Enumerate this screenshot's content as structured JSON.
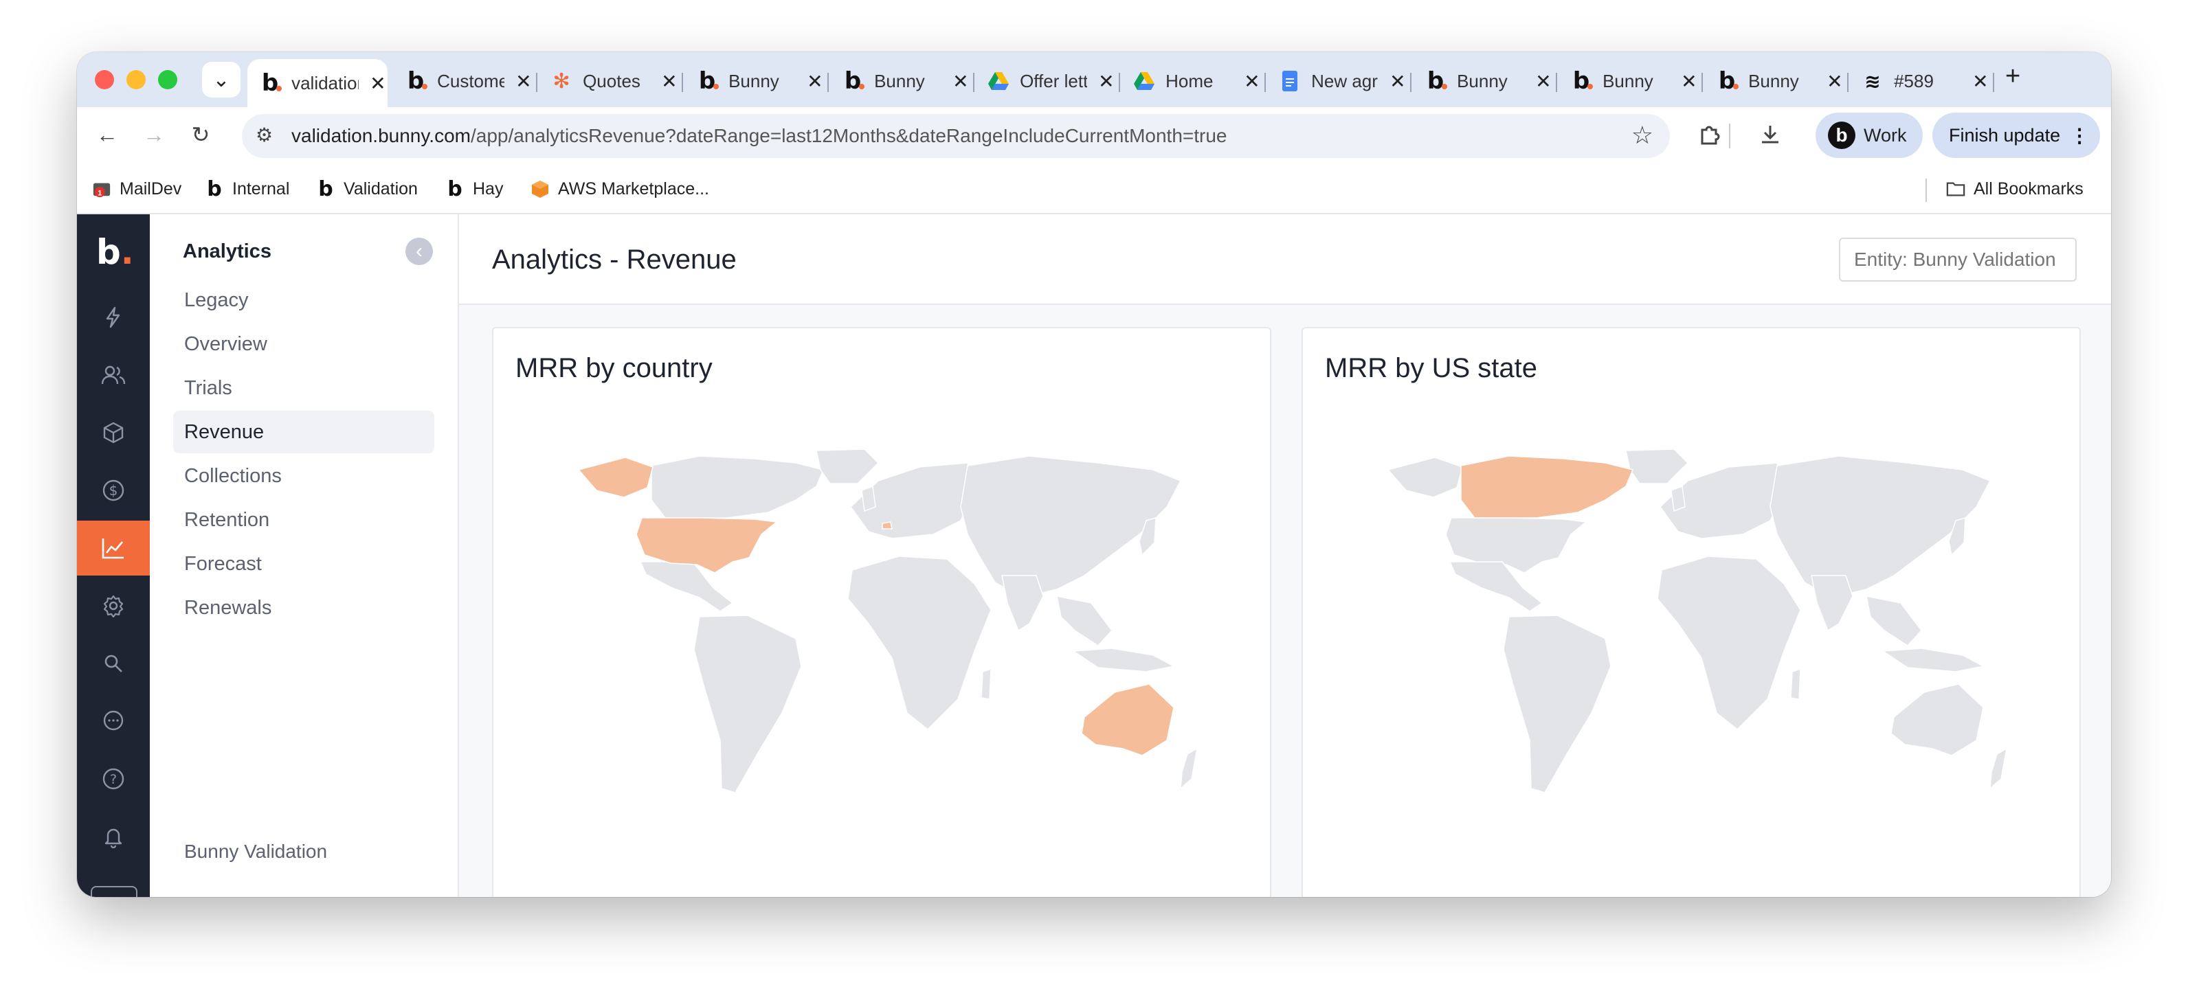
{
  "browser": {
    "tabs": [
      {
        "title": "validation.bunny.com",
        "icon": "bunny-logo-icon",
        "active": true
      },
      {
        "title": "Customers",
        "icon": "bunny-logo-icon"
      },
      {
        "title": "Quotes",
        "icon": "hubspot-icon"
      },
      {
        "title": "Bunny",
        "icon": "bunny-logo-icon"
      },
      {
        "title": "Bunny",
        "icon": "bunny-logo-icon"
      },
      {
        "title": "Offer letter",
        "icon": "google-drive-icon"
      },
      {
        "title": "Home",
        "icon": "google-drive-icon"
      },
      {
        "title": "New agreement",
        "icon": "google-docs-icon"
      },
      {
        "title": "Bunny",
        "icon": "bunny-logo-icon"
      },
      {
        "title": "Bunny",
        "icon": "bunny-logo-icon"
      },
      {
        "title": "Bunny",
        "icon": "bunny-logo-icon"
      },
      {
        "title": "#589",
        "icon": "stack-icon"
      }
    ],
    "url_host": "validation.bunny.com",
    "url_path": "/app/analyticsRevenue?dateRange=last12Months&dateRangeIncludeCurrentMonth=true",
    "profile_label": "Work",
    "update_label": "Finish update",
    "bookmarks": [
      {
        "label": "MailDev",
        "icon": "maildev-icon"
      },
      {
        "label": "Internal",
        "icon": "bunny-logo-icon"
      },
      {
        "label": "Validation",
        "icon": "bunny-logo-icon"
      },
      {
        "label": "Hay",
        "icon": "bunny-logo-icon"
      },
      {
        "label": "AWS Marketplace...",
        "icon": "aws-marketplace-icon"
      }
    ],
    "all_bookmarks_label": "All Bookmarks"
  },
  "app": {
    "logo": "b",
    "rail_items": [
      {
        "name": "quotes",
        "icon": "lightning-icon",
        "active": false
      },
      {
        "name": "customers",
        "icon": "users-icon",
        "active": false
      },
      {
        "name": "products",
        "icon": "box-icon",
        "active": false
      },
      {
        "name": "billing",
        "icon": "dollar-circle-icon",
        "active": false
      },
      {
        "name": "analytics",
        "icon": "chart-line-icon",
        "active": true
      },
      {
        "name": "settings",
        "icon": "gear-icon",
        "active": false
      },
      {
        "name": "search",
        "icon": "search-icon",
        "active": false
      },
      {
        "name": "chat",
        "icon": "chat-icon",
        "active": false
      },
      {
        "name": "help",
        "icon": "help-icon",
        "active": false
      },
      {
        "name": "notifications",
        "icon": "bell-icon",
        "active": false
      }
    ],
    "subnav": {
      "heading": "Analytics",
      "items": [
        "Legacy",
        "Overview",
        "Trials",
        "Revenue",
        "Collections",
        "Retention",
        "Forecast",
        "Renewals"
      ],
      "active_item": "Revenue",
      "footer": "Bunny Validation"
    },
    "page_title": "Analytics - Revenue",
    "entity_placeholder": "Entity: Bunny Validation",
    "cards": [
      {
        "title": "MRR by country",
        "highlighted_regions": [
          "United States",
          "Alaska",
          "Australia",
          "Switzerland"
        ]
      },
      {
        "title": "MRR by US state",
        "highlighted_regions": [
          "Canada"
        ]
      }
    ],
    "colors": {
      "accent": "#f26b3a",
      "map_base": "#e3e4e8",
      "map_highlight": "#f6bd9b",
      "rail_bg": "#1f2433"
    }
  }
}
